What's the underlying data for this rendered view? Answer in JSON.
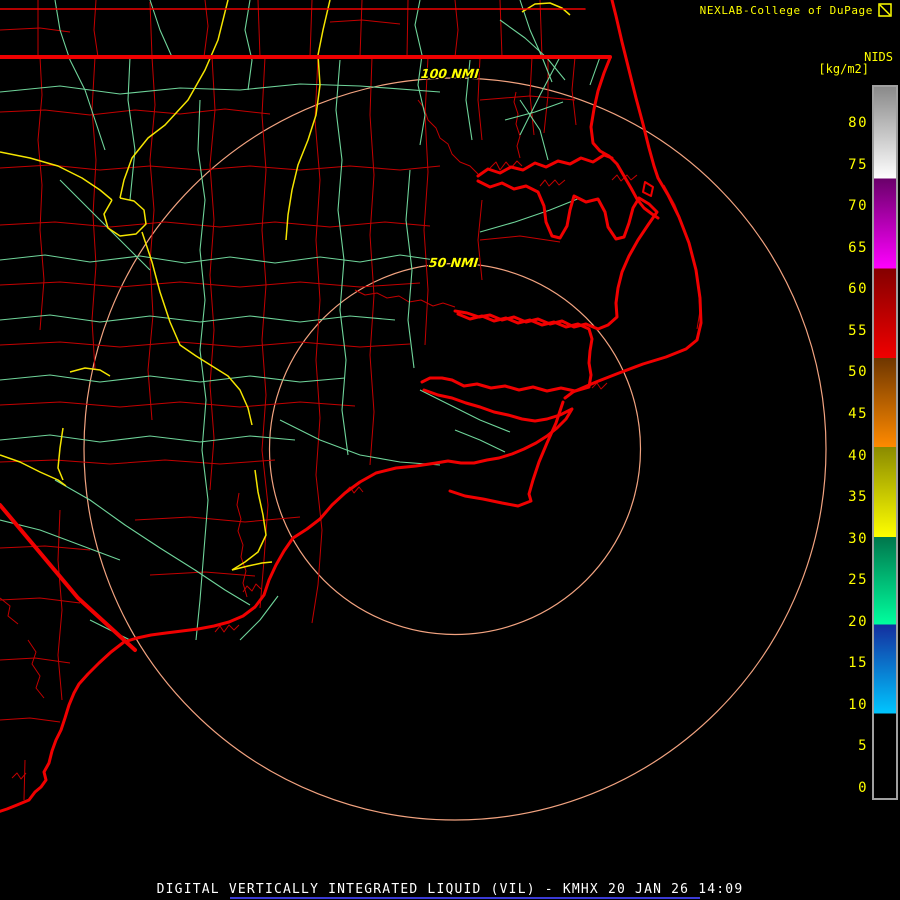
{
  "header": {
    "title": "NEXLAB-College of DuPage",
    "logo_icon": "college-of-dupage-mark"
  },
  "legend": {
    "system_label": "NIDS",
    "unit_label": "[kg/m2]",
    "ticks": [
      80,
      75,
      70,
      65,
      60,
      55,
      50,
      45,
      40,
      35,
      30,
      25,
      20,
      15,
      10,
      5,
      0
    ],
    "bands": [
      {
        "from_pct": 0,
        "to_pct": 12.9,
        "top_color": "#8a8a8a",
        "bottom_color": "#ffffff"
      },
      {
        "from_pct": 12.9,
        "to_pct": 25.5,
        "top_color": "#6a006a",
        "bottom_color": "#ff00ff"
      },
      {
        "from_pct": 25.5,
        "to_pct": 38.1,
        "top_color": "#840000",
        "bottom_color": "#f00000"
      },
      {
        "from_pct": 38.1,
        "to_pct": 50.6,
        "top_color": "#6e3600",
        "bottom_color": "#ff8a00"
      },
      {
        "from_pct": 50.6,
        "to_pct": 63.3,
        "top_color": "#8a8a00",
        "bottom_color": "#ffff00"
      },
      {
        "from_pct": 63.3,
        "to_pct": 75.6,
        "top_color": "#00764c",
        "bottom_color": "#00ff9e"
      },
      {
        "from_pct": 75.6,
        "to_pct": 88.1,
        "top_color": "#142e9e",
        "bottom_color": "#00c6ff"
      },
      {
        "from_pct": 88.1,
        "to_pct": 100,
        "top_color": "#000000",
        "bottom_color": "#000000"
      }
    ]
  },
  "map": {
    "range_ring_labels": [
      "100 NMI",
      "50 NMI"
    ],
    "radar_site": "KMHX"
  },
  "caption": {
    "text": "DIGITAL VERTICALLY INTEGRATED LIQUID (VIL) - KMHX 20 JAN 26 14:09"
  },
  "colors": {
    "background": "#000000",
    "title_text": "#ffff00",
    "caption_text": "#ffffff",
    "coastline": "#f00000",
    "state_border": "#f00000",
    "county_line": "#c40000",
    "road": "#6fd49a",
    "highway": "#f5e500",
    "range_ring": "#f2a380",
    "ring_label": "#ffff00",
    "legend_tick": "#ffff00",
    "legend_border": "#a0a0a0",
    "footer_line": "#3b3bd6"
  }
}
